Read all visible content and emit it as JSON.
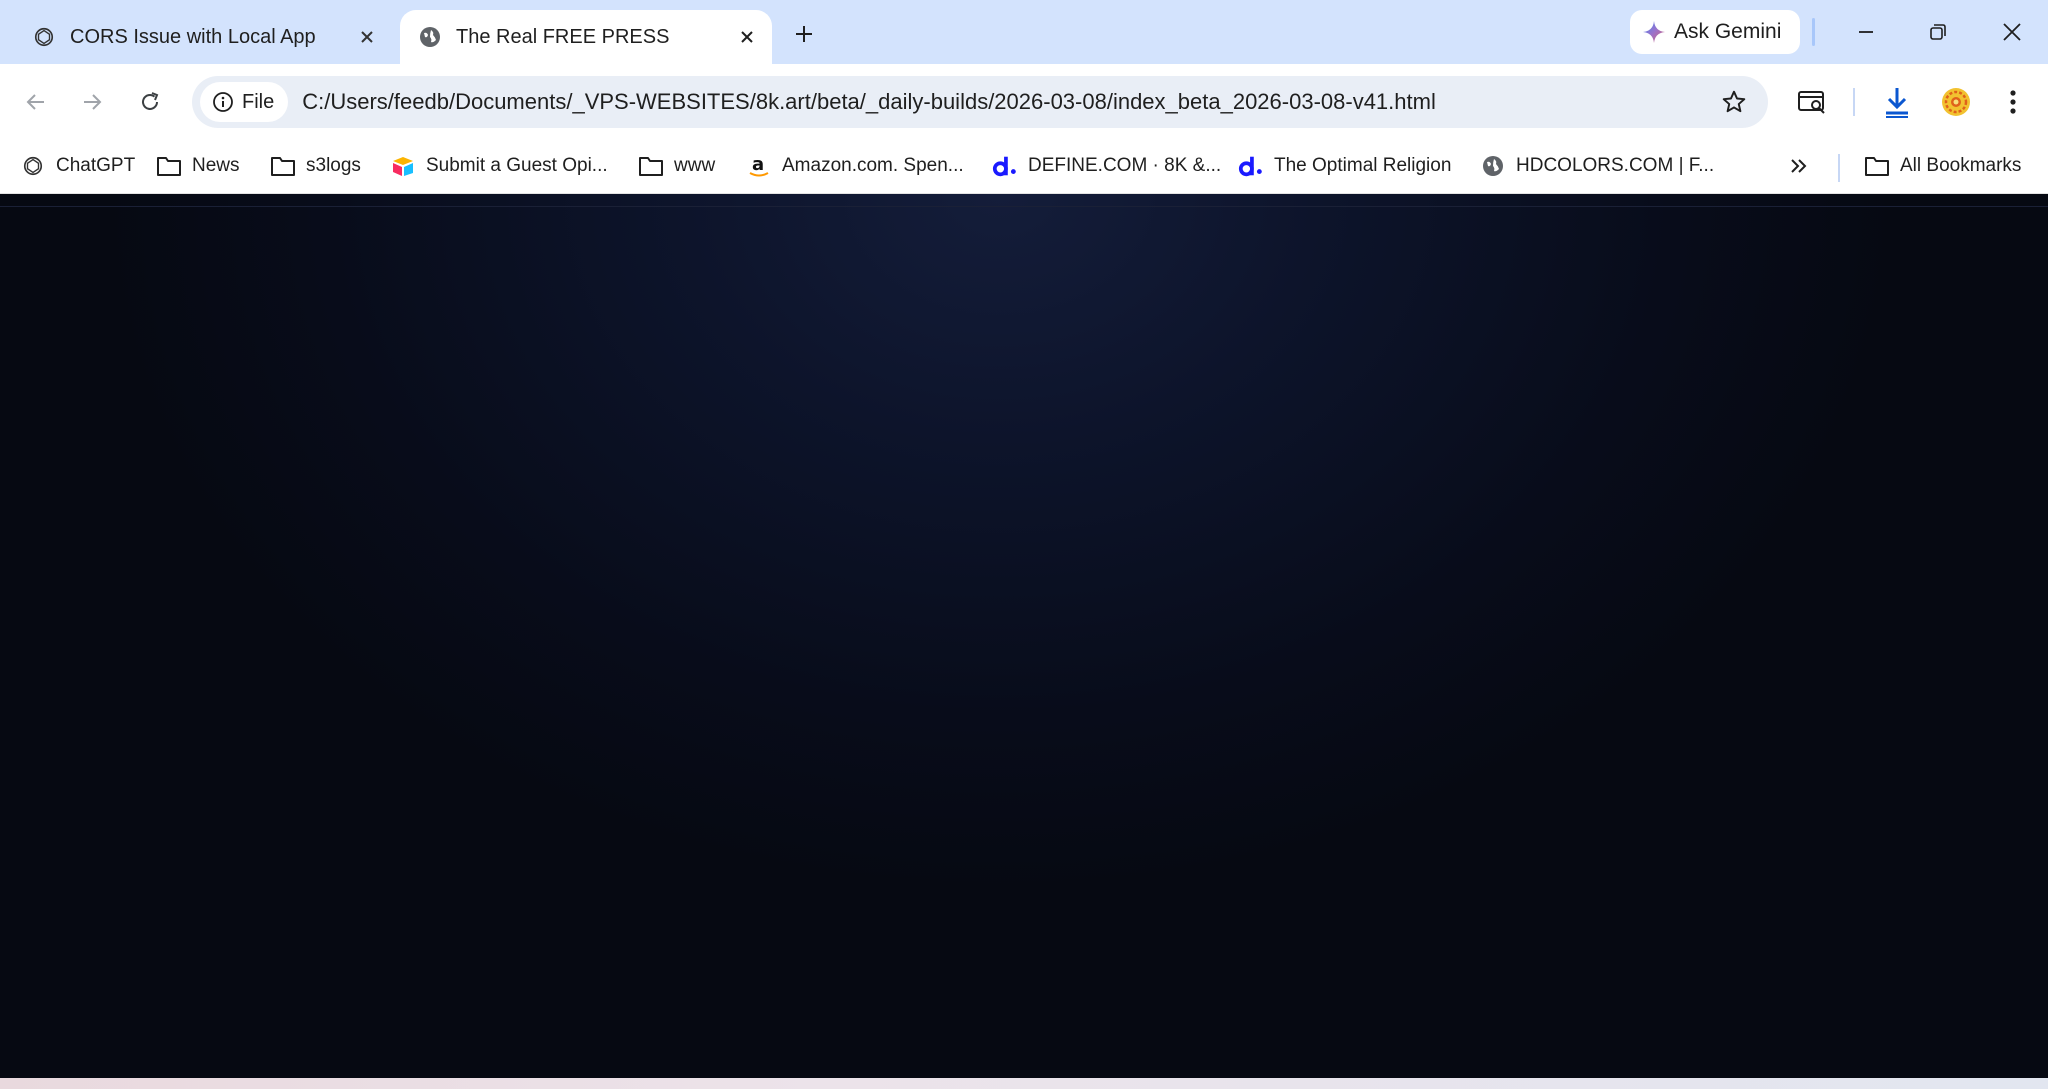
{
  "tabs": [
    {
      "title": "CORS Issue with Local App",
      "icon": "chatgpt-icon",
      "active": false
    },
    {
      "title": "The Real FREE PRESS",
      "icon": "globe-icon",
      "active": true
    }
  ],
  "gemini": {
    "label": "Ask Gemini"
  },
  "address": {
    "scheme_chip": "File",
    "url": "C:/Users/feedb/Documents/_VPS-WEBSITES/8k.art/beta/_daily-builds/2026-03-08/index_beta_2026-03-08-v41.html"
  },
  "bookmarks": [
    {
      "label": "ChatGPT",
      "icon": "chatgpt-icon"
    },
    {
      "label": "News",
      "icon": "folder-icon"
    },
    {
      "label": "s3logs",
      "icon": "folder-icon"
    },
    {
      "label": "Submit a Guest Opi...",
      "icon": "airtable-icon"
    },
    {
      "label": "www",
      "icon": "folder-icon"
    },
    {
      "label": "Amazon.com. Spen...",
      "icon": "amazon-icon"
    },
    {
      "label": "DEFINE.COM · 8K &...",
      "icon": "define-d-icon"
    },
    {
      "label": "The Optimal Religion",
      "icon": "define-d-icon"
    },
    {
      "label": "HDCOLORS.COM | F...",
      "icon": "globe-icon"
    }
  ],
  "all_bookmarks": {
    "label": "All Bookmarks"
  },
  "colors": {
    "tabstrip": "#d3e3fd",
    "omnibox": "#e9eef6",
    "page_background": "#0a0e1a",
    "accent_blue": "#0b57d0"
  }
}
